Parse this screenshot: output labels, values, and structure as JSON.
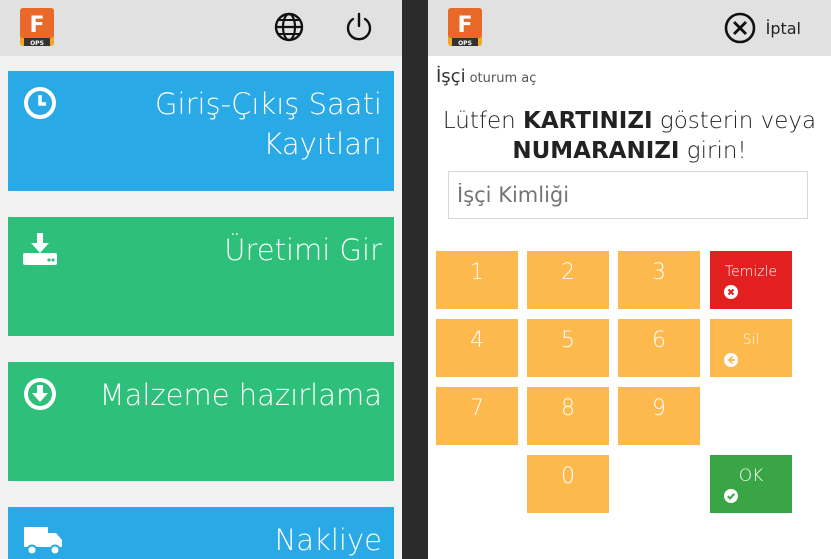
{
  "left": {
    "tiles": [
      {
        "label": "Giriş-Çıkış Saati\nKayıtları",
        "icon": "clock-icon"
      },
      {
        "label": "Üretimi Gir",
        "icon": "download-tray-icon"
      },
      {
        "label": "Malzeme hazırlama",
        "icon": "download-circle-icon"
      },
      {
        "label": "Nakliye",
        "icon": "truck-icon"
      }
    ],
    "logo_text": "F",
    "logo_sub": "OPS"
  },
  "right": {
    "cancel_label": "İptal",
    "title": "İşçi",
    "subtitle": "oturum aç",
    "prompt": {
      "part1": "Lütfen ",
      "part2": "KARTINIZI",
      "part3": " gösterin veya",
      "part4": "NUMARANIZI",
      "part5": " girin!"
    },
    "id_placeholder": "İşçi Kimliği",
    "keys": [
      "1",
      "2",
      "3",
      "4",
      "5",
      "6",
      "7",
      "8",
      "9",
      "0"
    ],
    "clear_label": "Temizle",
    "delete_label": "Sil",
    "ok_label": "OK"
  },
  "colors": {
    "blue_tile": "#29a9e6",
    "green_tile": "#2ec07a",
    "keypad": "#fdb94d",
    "clear": "#e32020",
    "ok": "#3aa545"
  }
}
